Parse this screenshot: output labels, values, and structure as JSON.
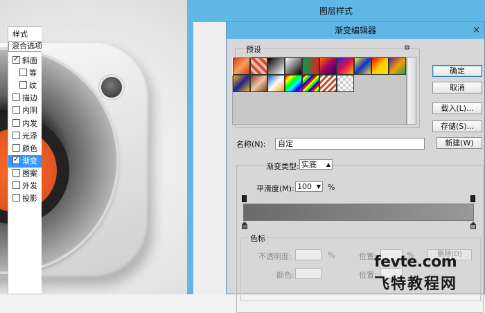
{
  "layer_style": {
    "title": "图层样式",
    "panel_header": "样式",
    "blend_options": "混合选项",
    "items": [
      {
        "label": "斜面",
        "checked": true,
        "sub": false,
        "selected": false
      },
      {
        "label": "等",
        "checked": false,
        "sub": true,
        "selected": false
      },
      {
        "label": "纹",
        "checked": false,
        "sub": true,
        "selected": false
      },
      {
        "label": "描边",
        "checked": false,
        "sub": false,
        "selected": false
      },
      {
        "label": "内阴",
        "checked": false,
        "sub": false,
        "selected": false
      },
      {
        "label": "内发",
        "checked": false,
        "sub": false,
        "selected": false
      },
      {
        "label": "光泽",
        "checked": false,
        "sub": false,
        "selected": false
      },
      {
        "label": "颜色",
        "checked": false,
        "sub": false,
        "selected": false
      },
      {
        "label": "渐变",
        "checked": true,
        "sub": false,
        "selected": true
      },
      {
        "label": "图案",
        "checked": false,
        "sub": false,
        "selected": false
      },
      {
        "label": "外发",
        "checked": false,
        "sub": false,
        "selected": false
      },
      {
        "label": "投影",
        "checked": false,
        "sub": false,
        "selected": false
      }
    ]
  },
  "gradient_editor": {
    "title": "渐变编辑器",
    "close": "×",
    "presets_label": "预设",
    "presets_gear": "⚙",
    "swatches_row1": [
      "linear-gradient(135deg,#e0351b,#f4a15c,#e0351b)",
      "repeating-linear-gradient(45deg,#d0503a 0 4px,#f5b8a0 4px 8px)",
      "linear-gradient(135deg,#000,#fff)",
      "linear-gradient(135deg,#fff,#000)",
      "linear-gradient(90deg,#00a050,#e02020)",
      "linear-gradient(135deg,#ff6a00,#a00060,#200060)",
      "linear-gradient(135deg,#3020c0,#e01050,#f0c000)",
      "linear-gradient(135deg,#f8f020,#1030d0,#f0e020)",
      "linear-gradient(135deg,#ff0000,#ffd000,#ffe000)",
      "linear-gradient(135deg,#6020a0,#f0a000,#20a040)"
    ],
    "swatches_row2": [
      "linear-gradient(135deg,#f0c000,#20209a,#f0c000)",
      "linear-gradient(135deg,#7a3a10,#f0c8a0,#7a3a10)",
      "linear-gradient(135deg,#1060c0,#ffffff,#f0a000)",
      "linear-gradient(135deg,#ff0000,#ffff00,#00ff00,#00ffff,#0000ff,#ff00ff)",
      "repeating-linear-gradient(135deg,#ff0000 0 3px,#ffff00 3px 6px,#00ff00 6px 9px,#0000ff 9px 12px)",
      "repeating-linear-gradient(135deg,#c05030 0 3px,#ffffff 3px 6px)",
      "repeating-conic-gradient(#ccc 0 25%,#fff 0 50%) 0 0/8px 8px"
    ],
    "buttons": {
      "ok": "确定",
      "cancel": "取消",
      "load": "载入(L)...",
      "save": "存储(S)...",
      "new": "新建(W)"
    },
    "name_label": "名称(N):",
    "name_value": "自定",
    "gradient_type_label": "渐变类型:",
    "gradient_type_value": "实底",
    "smoothness_label": "平滑度(M):",
    "smoothness_value": "100",
    "smoothness_unit": "%",
    "gradient_colors": [
      "#6a6a6a",
      "#9a9898"
    ],
    "color_stops_label": "色标",
    "opacity_label": "不透明度:",
    "opacity_unit": "%",
    "location_label": "位置:",
    "location_unit": "%",
    "delete_button": "删除(D)",
    "color_label": "颜色:",
    "location_label_2": "位置:"
  },
  "watermark": {
    "url": "fevte.com",
    "site": "飞特教程网"
  }
}
